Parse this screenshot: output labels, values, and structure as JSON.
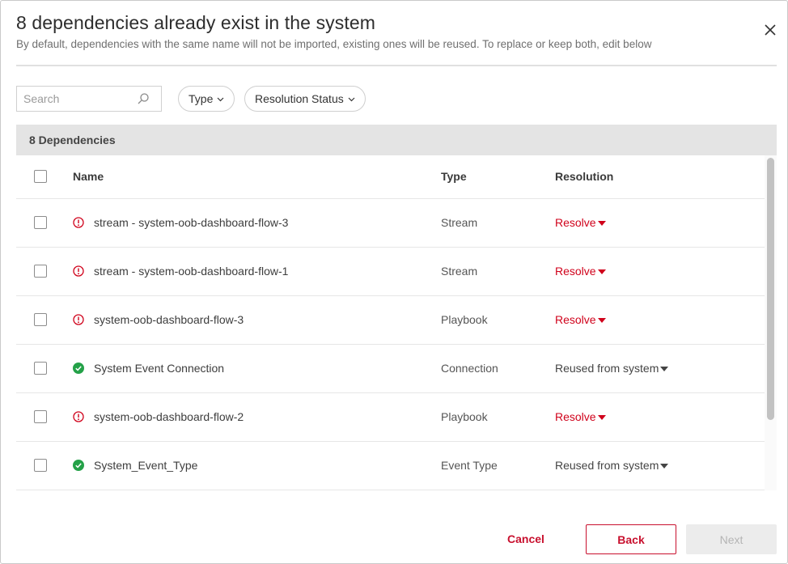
{
  "modal": {
    "title": "8 dependencies already exist in the system",
    "subtitle": "By default, dependencies with the same name will not be imported, existing ones will be reused. To replace or keep both, edit below",
    "close_icon": "close-icon"
  },
  "filters": {
    "search_placeholder": "Search",
    "search_value": "",
    "type_label": "Type",
    "resolution_status_label": "Resolution Status"
  },
  "table": {
    "count_label": "8 Dependencies",
    "headers": {
      "name": "Name",
      "type": "Type",
      "resolution": "Resolution"
    },
    "rows": [
      {
        "status": "error",
        "status_icon": "error-circle-icon",
        "name": "stream - system-oob-dashboard-flow-3",
        "type": "Stream",
        "resolution": "Resolve"
      },
      {
        "status": "error",
        "status_icon": "error-circle-icon",
        "name": "stream - system-oob-dashboard-flow-1",
        "type": "Stream",
        "resolution": "Resolve"
      },
      {
        "status": "error",
        "status_icon": "error-circle-icon",
        "name": "system-oob-dashboard-flow-3",
        "type": "Playbook",
        "resolution": "Resolve"
      },
      {
        "status": "ok",
        "status_icon": "check-circle-icon",
        "name": "System Event Connection",
        "type": "Connection",
        "resolution": "Reused from system"
      },
      {
        "status": "error",
        "status_icon": "error-circle-icon",
        "name": "system-oob-dashboard-flow-2",
        "type": "Playbook",
        "resolution": "Resolve"
      },
      {
        "status": "ok",
        "status_icon": "check-circle-icon",
        "name": "System_Event_Type",
        "type": "Event Type",
        "resolution": "Reused from system"
      }
    ]
  },
  "footer": {
    "cancel_label": "Cancel",
    "back_label": "Back",
    "next_label": "Next"
  },
  "colors": {
    "accent_red": "#c8102e",
    "error_red": "#d0021b",
    "success_green": "#24a148",
    "header_bar": "#e4e4e4"
  }
}
